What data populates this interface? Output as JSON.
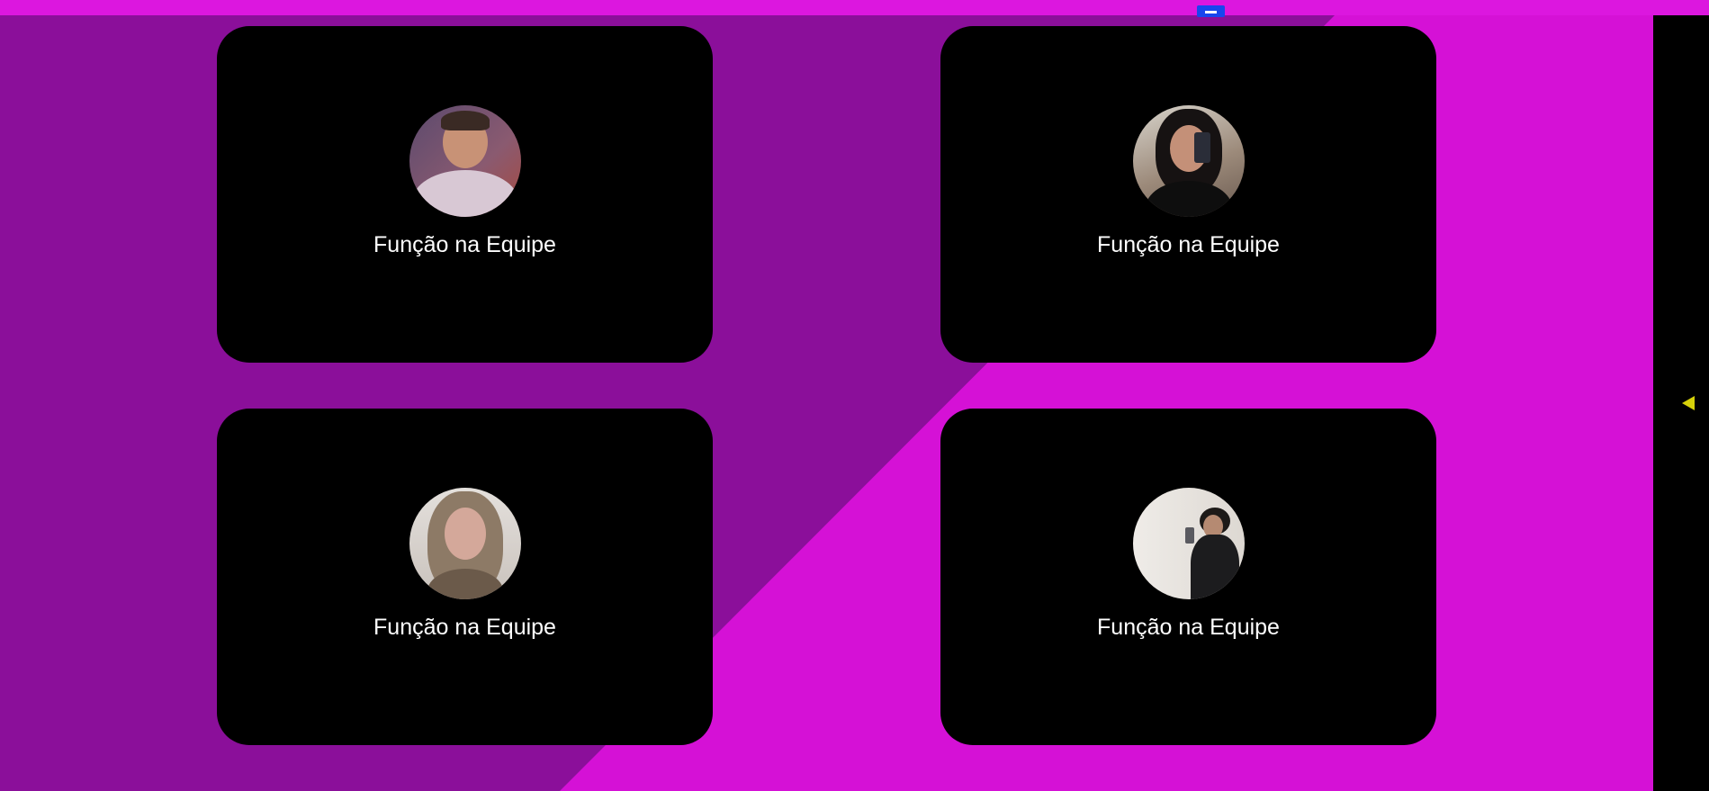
{
  "colors": {
    "background_dark": "#8b0f9a",
    "background_light": "#d511d6",
    "top_bar": "#dc17df",
    "card": "#000000",
    "text": "#ffffff",
    "top_button": "#1846ee",
    "side_arrow": "#d6d10a"
  },
  "top_bar": {
    "button_icon": "menu-icon"
  },
  "side_panel": {
    "toggle_icon": "caret-left-icon"
  },
  "team": {
    "members": [
      {
        "role": "Função na Equipe",
        "photo": "avatar-photo"
      },
      {
        "role": "Função na Equipe",
        "photo": "avatar-photo"
      },
      {
        "role": "Função na Equipe",
        "photo": "avatar-photo"
      },
      {
        "role": "Função na Equipe",
        "photo": "avatar-photo"
      }
    ]
  }
}
